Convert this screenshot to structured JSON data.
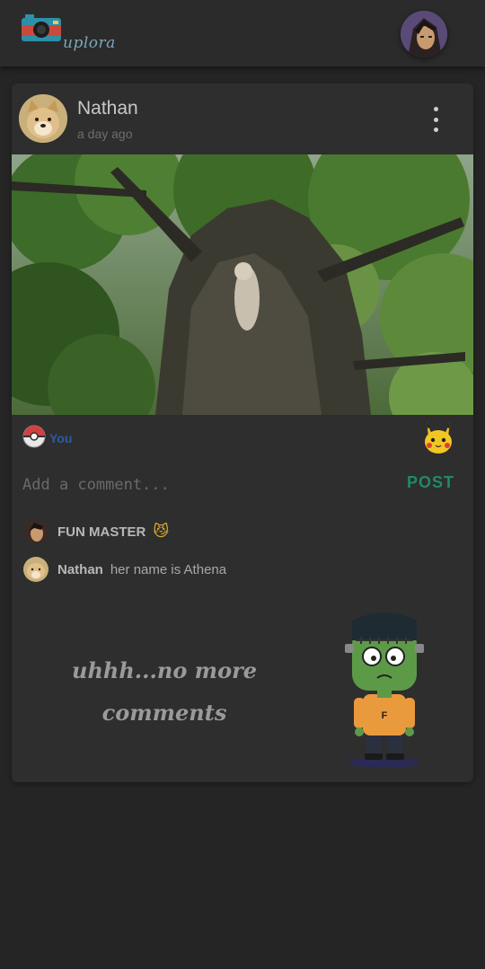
{
  "header": {
    "app_name": "uplora"
  },
  "post": {
    "author": "Nathan",
    "time_ago": "a day ago",
    "likes": {
      "liked_by": "You"
    },
    "comment_box": {
      "placeholder": "Add a comment...",
      "post_label": "POST"
    },
    "comments": [
      {
        "user": "FUN MASTER",
        "text": "",
        "emoji": "😼"
      },
      {
        "user": "Nathan",
        "text": "her name is Athena",
        "emoji": ""
      }
    ],
    "empty_state": {
      "line1": "uhhh...no more",
      "line2": "comments"
    }
  },
  "colors": {
    "background": "#252525",
    "card": "#2e2e2e",
    "post_button": "#1f8a66",
    "like_text": "#2f5aa0"
  },
  "icons": [
    "camera-logo-icon",
    "kebab-menu-icon",
    "pokeball-icon",
    "pikachu-icon",
    "frankenstein-illustration"
  ]
}
